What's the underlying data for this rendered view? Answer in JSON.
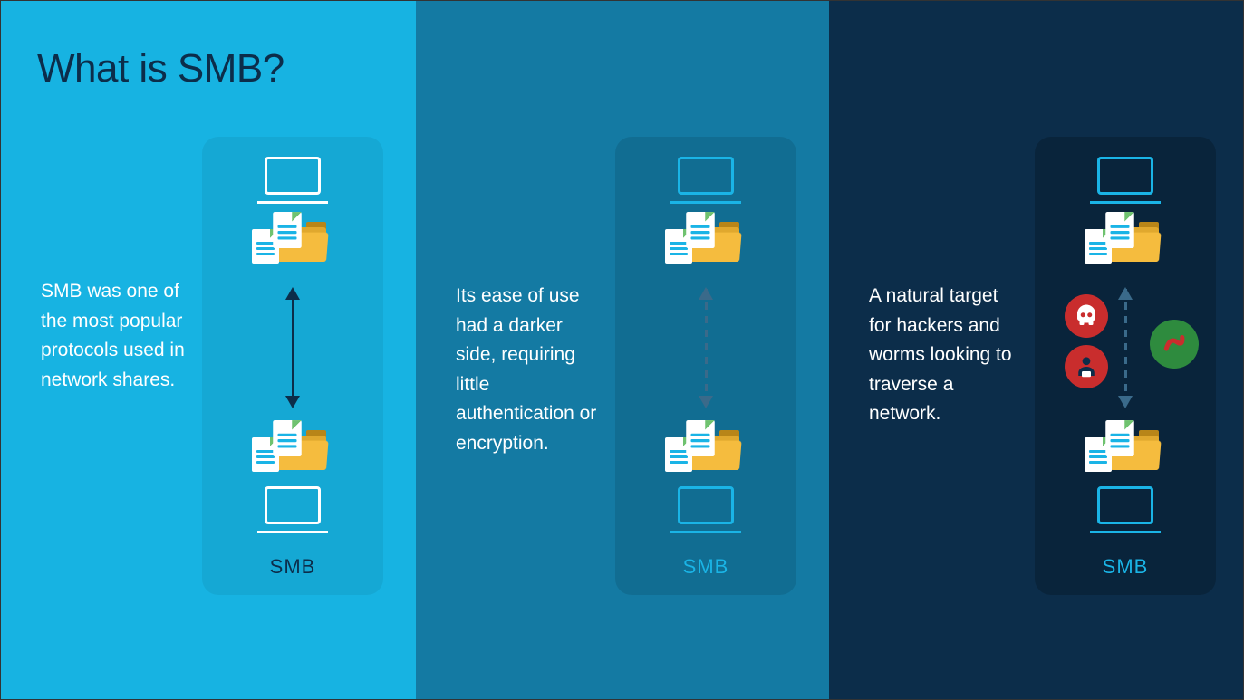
{
  "title": "What is SMB?",
  "panels": [
    {
      "text": "SMB was one of the most popular protocols used in network shares.",
      "caption": "SMB",
      "arrow_style": "solid",
      "threats": false,
      "bg": "#17b3e2"
    },
    {
      "text": "Its ease of use had a darker side, requiring little authentication or encryption.",
      "caption": "SMB",
      "arrow_style": "dashed",
      "threats": false,
      "bg": "#147aa3"
    },
    {
      "text": "A natural target for hackers and worms looking to traverse a network.",
      "caption": "SMB",
      "arrow_style": "dashed",
      "threats": true,
      "bg": "#0c2d4a"
    }
  ],
  "icons": {
    "laptop": "laptop-icon",
    "folder": "folder-files-icon",
    "skull": "skull-icon",
    "hacker": "hacker-icon",
    "worm": "worm-icon"
  }
}
